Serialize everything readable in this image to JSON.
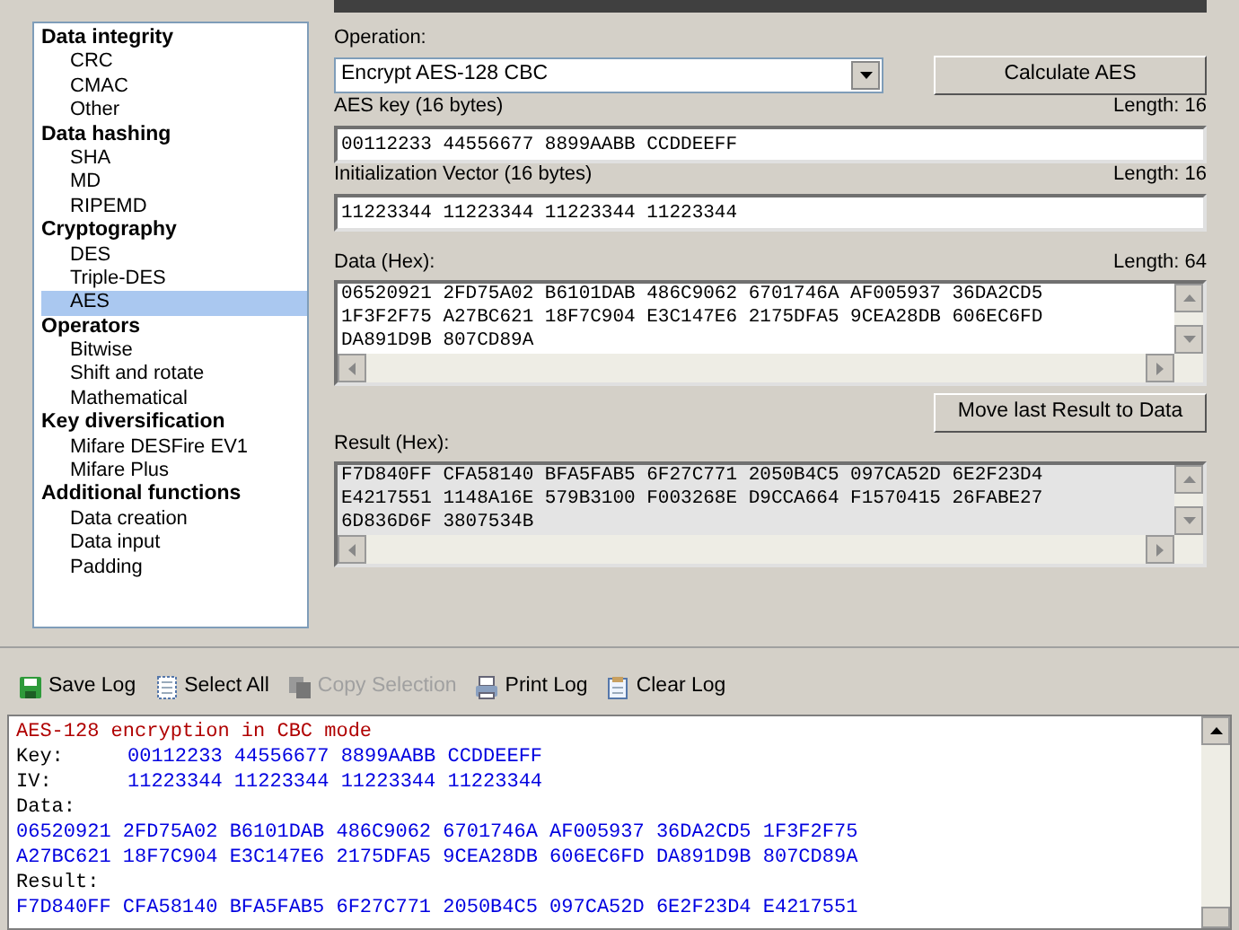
{
  "tree": [
    {
      "label": "Data integrity",
      "children": [
        {
          "label": "CRC",
          "selected": false
        },
        {
          "label": "CMAC",
          "selected": false
        },
        {
          "label": "Other",
          "selected": false
        }
      ]
    },
    {
      "label": "Data hashing",
      "children": [
        {
          "label": "SHA",
          "selected": false
        },
        {
          "label": "MD",
          "selected": false
        },
        {
          "label": "RIPEMD",
          "selected": false
        }
      ]
    },
    {
      "label": "Cryptography",
      "children": [
        {
          "label": "DES",
          "selected": false
        },
        {
          "label": "Triple-DES",
          "selected": false
        },
        {
          "label": "AES",
          "selected": true
        }
      ]
    },
    {
      "label": "Operators",
      "children": [
        {
          "label": "Bitwise",
          "selected": false
        },
        {
          "label": "Shift and rotate",
          "selected": false
        },
        {
          "label": "Mathematical",
          "selected": false
        }
      ]
    },
    {
      "label": "Key diversification",
      "children": [
        {
          "label": "Mifare DESFire EV1",
          "selected": false
        },
        {
          "label": "Mifare Plus",
          "selected": false
        }
      ]
    },
    {
      "label": "Additional functions",
      "children": [
        {
          "label": "Data creation",
          "selected": false
        },
        {
          "label": "Data input",
          "selected": false
        },
        {
          "label": "Padding",
          "selected": false
        }
      ]
    }
  ],
  "operation": {
    "label": "Operation:",
    "value": "Encrypt AES-128 CBC"
  },
  "calculate_button": "Calculate AES",
  "key": {
    "label": "AES key (16 bytes)",
    "length": "Length: 16",
    "value": "00112233 44556677 8899AABB CCDDEEFF"
  },
  "iv": {
    "label": "Initialization Vector (16 bytes)",
    "length": "Length: 16",
    "value": "11223344 11223344 11223344 11223344"
  },
  "data": {
    "label": "Data (Hex):",
    "length": "Length: 64",
    "lines": [
      "06520921 2FD75A02 B6101DAB 486C9062 6701746A AF005937 36DA2CD5",
      "1F3F2F75 A27BC621 18F7C904 E3C147E6 2175DFA5 9CEA28DB 606EC6FD",
      "DA891D9B 807CD89A"
    ]
  },
  "move_button": "Move last Result to Data",
  "result": {
    "label": "Result (Hex):",
    "lines": [
      "F7D840FF CFA58140 BFA5FAB5 6F27C771 2050B4C5 097CA52D 6E2F23D4",
      "E4217551 1148A16E 579B3100 F003268E D9CCA664 F1570415 26FABE27",
      "6D836D6F 3807534B"
    ]
  },
  "log_toolbar": [
    {
      "kind": "save",
      "label": "Save Log",
      "disabled": false
    },
    {
      "kind": "select",
      "label": "Select All",
      "disabled": false
    },
    {
      "kind": "copy",
      "label": "Copy Selection",
      "disabled": true
    },
    {
      "kind": "print",
      "label": "Print Log",
      "disabled": false
    },
    {
      "kind": "clear",
      "label": "Clear Log",
      "disabled": false
    }
  ],
  "log": [
    {
      "kind": "title",
      "text": "AES-128 encryption in CBC mode"
    },
    {
      "kind": "field",
      "label": "Key:",
      "text": "00112233 44556677 8899AABB CCDDEEFF"
    },
    {
      "kind": "field",
      "label": "IV:",
      "text": "11223344 11223344 11223344 11223344"
    },
    {
      "kind": "heading",
      "text": "Data:"
    },
    {
      "kind": "value",
      "text": "06520921 2FD75A02 B6101DAB 486C9062 6701746A AF005937 36DA2CD5 1F3F2F75"
    },
    {
      "kind": "value",
      "text": "A27BC621 18F7C904 E3C147E6 2175DFA5 9CEA28DB 606EC6FD DA891D9B 807CD89A"
    },
    {
      "kind": "heading",
      "text": "Result:"
    },
    {
      "kind": "value",
      "text": "F7D840FF CFA58140 BFA5FAB5 6F27C771 2050B4C5 097CA52D 6E2F23D4 E4217551"
    }
  ]
}
